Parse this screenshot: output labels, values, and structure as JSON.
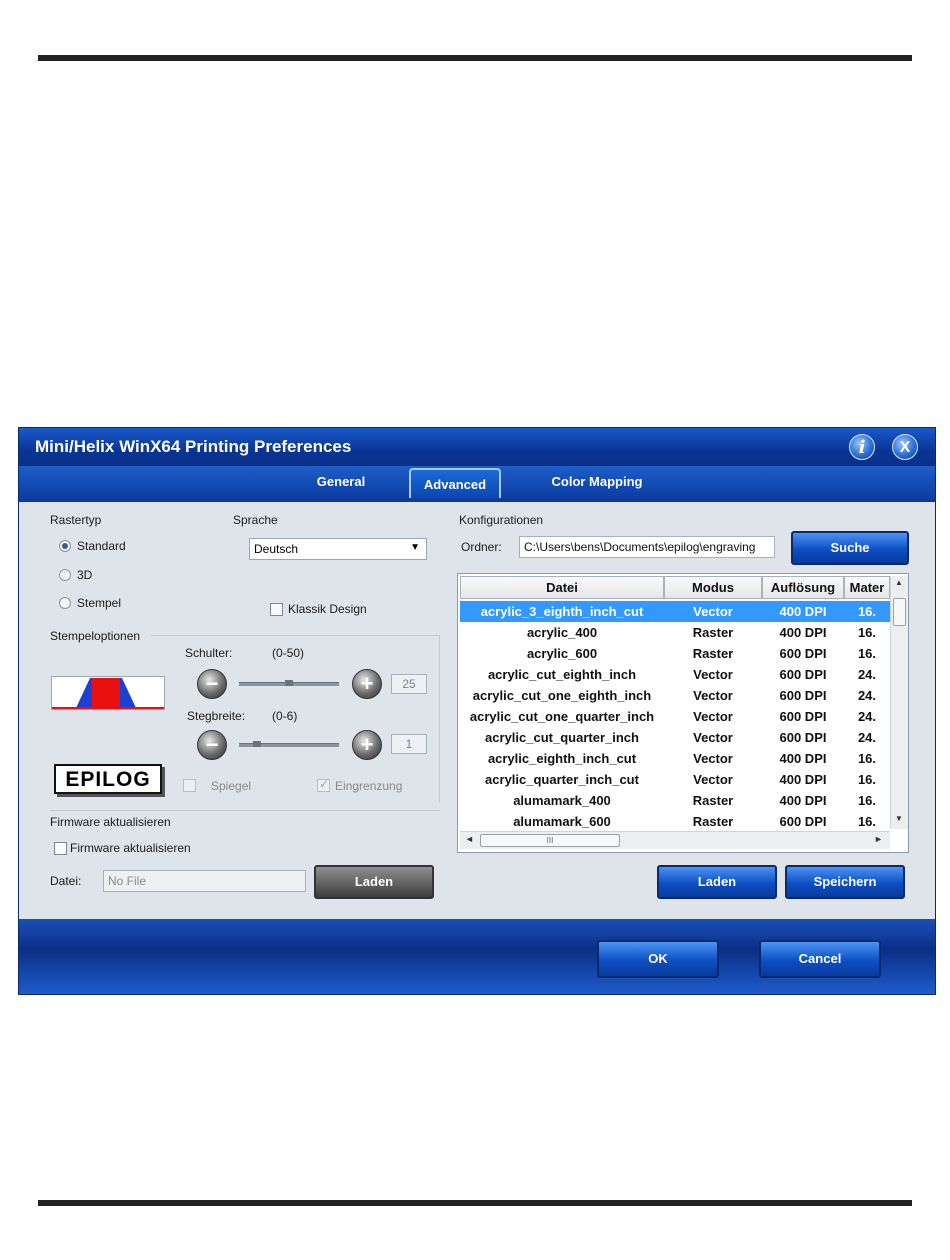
{
  "dialog": {
    "title": "Mini/Helix WinX64 Printing Preferences",
    "info_icon": "i",
    "close_icon": "X"
  },
  "tabs": [
    {
      "label": "General"
    },
    {
      "label": "Advanced"
    },
    {
      "label": "Color Mapping"
    }
  ],
  "rastertyp": {
    "label": "Rastertyp",
    "options": [
      {
        "label": "Standard",
        "selected": true
      },
      {
        "label": "3D",
        "selected": false
      },
      {
        "label": "Stempel",
        "selected": false
      }
    ]
  },
  "sprache": {
    "label": "Sprache",
    "value": "Deutsch"
  },
  "klassik_design": {
    "label": "Klassik Design",
    "checked": false
  },
  "stempeloptionen": {
    "label": "Stempeloptionen",
    "schulter": {
      "label": "Schulter:",
      "range": "(0-50)",
      "value": "25"
    },
    "stegbreite": {
      "label": "Stegbreite:",
      "range": "(0-6)",
      "value": "1"
    },
    "spiegel": {
      "label": "Spiegel",
      "checked": false
    },
    "eingrenzung": {
      "label": "Eingrenzung",
      "checked": true
    },
    "logo_text": "EPILOG"
  },
  "firmware": {
    "section_label": "Firmware aktualisieren",
    "checkbox_label": "Firmware aktualisieren",
    "file_label": "Datei:",
    "file_value": "No File",
    "load_button": "Laden"
  },
  "konfigurationen": {
    "label": "Konfigurationen",
    "folder_label": "Ordner:",
    "folder_value": "C:\\Users\\bens\\Documents\\epilog\\engraving",
    "search_button": "Suche",
    "columns": [
      "Datei",
      "Modus",
      "Auflösung",
      "Mater"
    ],
    "rows": [
      {
        "datei": "acrylic_3_eighth_inch_cut",
        "modus": "Vector",
        "aufloesung": "400 DPI",
        "mater": "16."
      },
      {
        "datei": "acrylic_400",
        "modus": "Raster",
        "aufloesung": "400 DPI",
        "mater": "16."
      },
      {
        "datei": "acrylic_600",
        "modus": "Raster",
        "aufloesung": "600 DPI",
        "mater": "16."
      },
      {
        "datei": "acrylic_cut_eighth_inch",
        "modus": "Vector",
        "aufloesung": "600 DPI",
        "mater": "24."
      },
      {
        "datei": "acrylic_cut_one_eighth_inch",
        "modus": "Vector",
        "aufloesung": "600 DPI",
        "mater": "24."
      },
      {
        "datei": "acrylic_cut_one_quarter_inch",
        "modus": "Vector",
        "aufloesung": "600 DPI",
        "mater": "24."
      },
      {
        "datei": "acrylic_cut_quarter_inch",
        "modus": "Vector",
        "aufloesung": "600 DPI",
        "mater": "24."
      },
      {
        "datei": "acrylic_eighth_inch_cut",
        "modus": "Vector",
        "aufloesung": "400 DPI",
        "mater": "16."
      },
      {
        "datei": "acrylic_quarter_inch_cut",
        "modus": "Vector",
        "aufloesung": "400 DPI",
        "mater": "16."
      },
      {
        "datei": "alumamark_400",
        "modus": "Raster",
        "aufloesung": "400 DPI",
        "mater": "16."
      },
      {
        "datei": "alumamark_600",
        "modus": "Raster",
        "aufloesung": "600 DPI",
        "mater": "16."
      }
    ],
    "hscroll_thumb_glyph": "III",
    "load_button": "Laden",
    "save_button": "Speichern"
  },
  "footer": {
    "ok_button": "OK",
    "cancel_button": "Cancel"
  }
}
